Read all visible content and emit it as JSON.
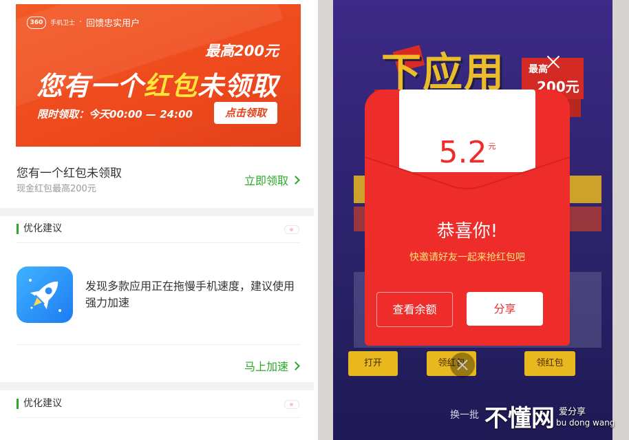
{
  "banner": {
    "brand_logo": "360",
    "brand_sub": "手机卫士",
    "brand_text": "回馈忠实用户",
    "max_amount": "最高200元",
    "headline_pre": "您有一个",
    "headline_highlight": "红包",
    "headline_post": "未领取",
    "time_text": "限时领取：今天00:00 — 24:00",
    "claim_button": "点击领取"
  },
  "redpacket_row": {
    "title": "您有一个红包未领取",
    "subtitle": "现金红包最高200元",
    "action": "立即领取"
  },
  "section1": {
    "title": "优化建议",
    "tip": "发现多款应用正在拖慢手机速度，建议使用强力加速",
    "action": "马上加速",
    "icon": "rocket-icon"
  },
  "section2": {
    "title": "优化建议"
  },
  "popup": {
    "amount": "5.2",
    "unit": "元",
    "congrats": "恭喜你!",
    "invite": "快邀请好友一起来抢红包吧",
    "balance_button": "查看余额",
    "share_button": "分享"
  },
  "background_app": {
    "title": "下应用",
    "badge_line1": "最高",
    "badge_line2": "200元",
    "bottom_buttons": [
      "打开",
      "领红包",
      "领红包"
    ],
    "refresh_text": "换一批"
  },
  "watermark": {
    "main": "不懂网",
    "sub": "爱分享",
    "pinyin": "bu dong wang"
  },
  "colors": {
    "accent_green": "#29a828",
    "banner_orange": "#ee4a1d",
    "envelope_red": "#ee2d2a",
    "highlight_yellow": "#ffe43a"
  }
}
